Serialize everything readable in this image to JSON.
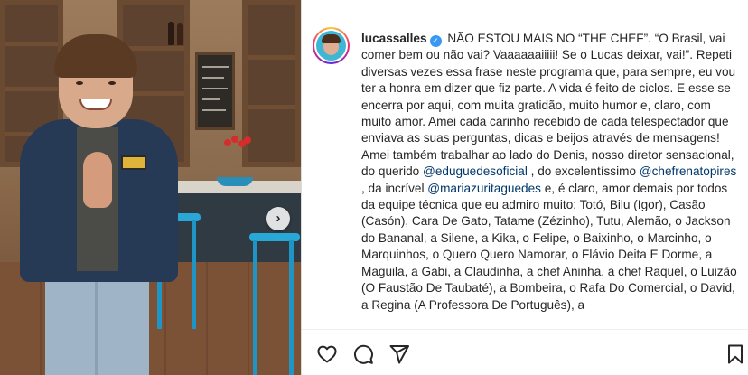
{
  "post": {
    "username": "lucassalles",
    "verified_icon": "verified-badge-icon",
    "caption": {
      "p1": "NÃO ESTOU MAIS NO “THE CHEF”. “O Brasil, vai comer bem ou não vai? Vaaaaaaiiiii! Se o Lucas deixar, vai!”. Repeti diversas vezes essa frase neste programa que, para sempre, eu vou ter a honra em dizer que fiz parte. A vida é feito de ciclos. E esse se encerra por aqui, com muita gratidão, muito humor e, claro, com muito amor. Amei cada carinho recebido de cada telespectador que enviava as suas perguntas, dicas e beijos através de mensagens! Amei também trabalhar ao lado do Denis, nosso diretor sensacional, do querido ",
      "mention1": "@eduguedesoficial",
      "p2": " , do excelentíssimo ",
      "mention2": "@chefrenatopires",
      "p3": " , da incrível ",
      "mention3": "@mariazuritaguedes",
      "p4": " e, é claro, amor demais por todos da equipe técnica que eu admiro muito: Totó, Bilu (Igor), Casão (Casón), Cara De Gato, Tatame (Zézinho), Tutu, Alemão, o Jackson do Bananal, a Silene, a Kika, o Felipe, o Baixinho, o Marcinho, o Marquinhos, o Quero Quero Namorar, o Flávio Deita E Dorme, a Maguila, a Gabi, a Claudinha, a chef Aninha, a chef Raquel, o Luizão (O Faustão De Taubaté), a Bombeira, o Rafa Do Comercial, o David, a Regina (A Professora De Português), a"
    }
  },
  "carousel": {
    "next_icon": "chevron-right-icon",
    "next_glyph": "›"
  },
  "actions": [
    "heart-icon",
    "comment-icon",
    "share-icon",
    "bookmark-icon"
  ],
  "colors": {
    "link": "#00376b",
    "verified": "#3897f0",
    "text": "#262626"
  }
}
